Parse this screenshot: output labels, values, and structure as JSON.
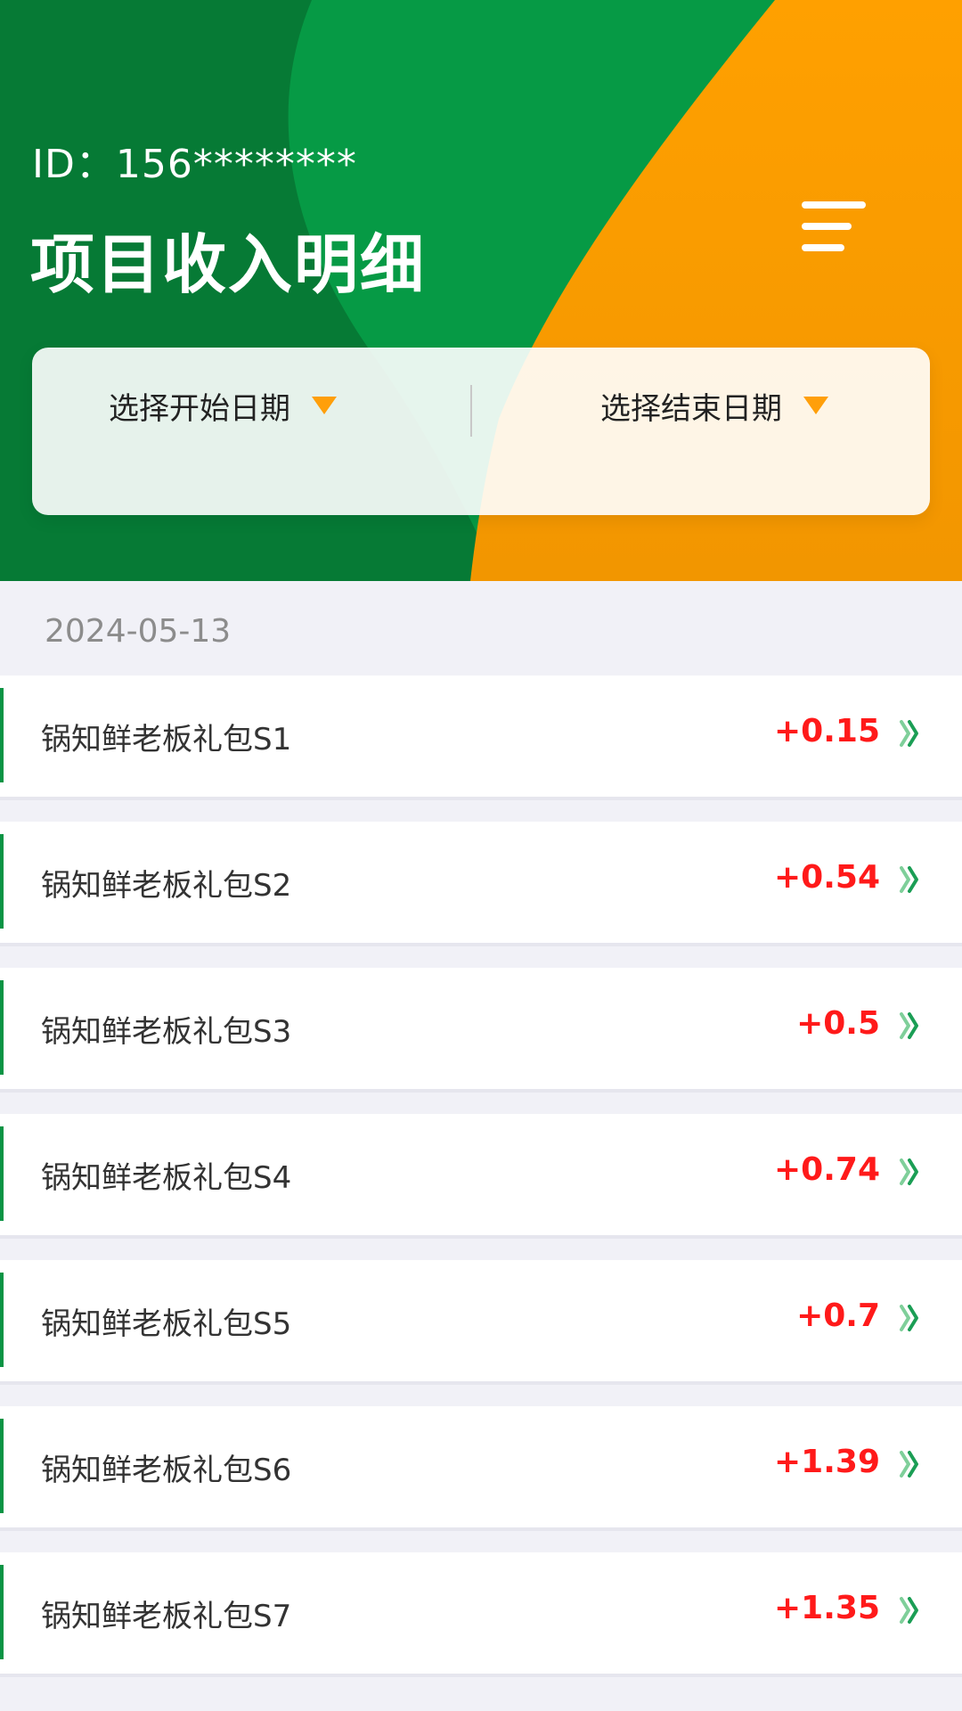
{
  "header": {
    "id_label": "ID：",
    "id_value": "156********",
    "title": "项目收入明细",
    "colors": {
      "green": "#069a45",
      "dark_green": "#067030",
      "orange": "#ff9f00"
    }
  },
  "menu": {
    "icon": "menu-icon"
  },
  "filter": {
    "start_label": "选择开始日期",
    "end_label": "选择结束日期",
    "dropdown_icon": "caret-down-icon",
    "accent_color": "#ff9f0a"
  },
  "list": {
    "date": "2024-05-13",
    "amount_color": "#ff1a1a",
    "items": [
      {
        "name": "锅知鲜老板礼包S1",
        "amount": "+0.15"
      },
      {
        "name": "锅知鲜老板礼包S2",
        "amount": "+0.54"
      },
      {
        "name": "锅知鲜老板礼包S3",
        "amount": "+0.5"
      },
      {
        "name": "锅知鲜老板礼包S4",
        "amount": "+0.74"
      },
      {
        "name": "锅知鲜老板礼包S5",
        "amount": "+0.7"
      },
      {
        "name": "锅知鲜老板礼包S6",
        "amount": "+1.39"
      },
      {
        "name": "锅知鲜老板礼包S7",
        "amount": "+1.35"
      }
    ]
  }
}
